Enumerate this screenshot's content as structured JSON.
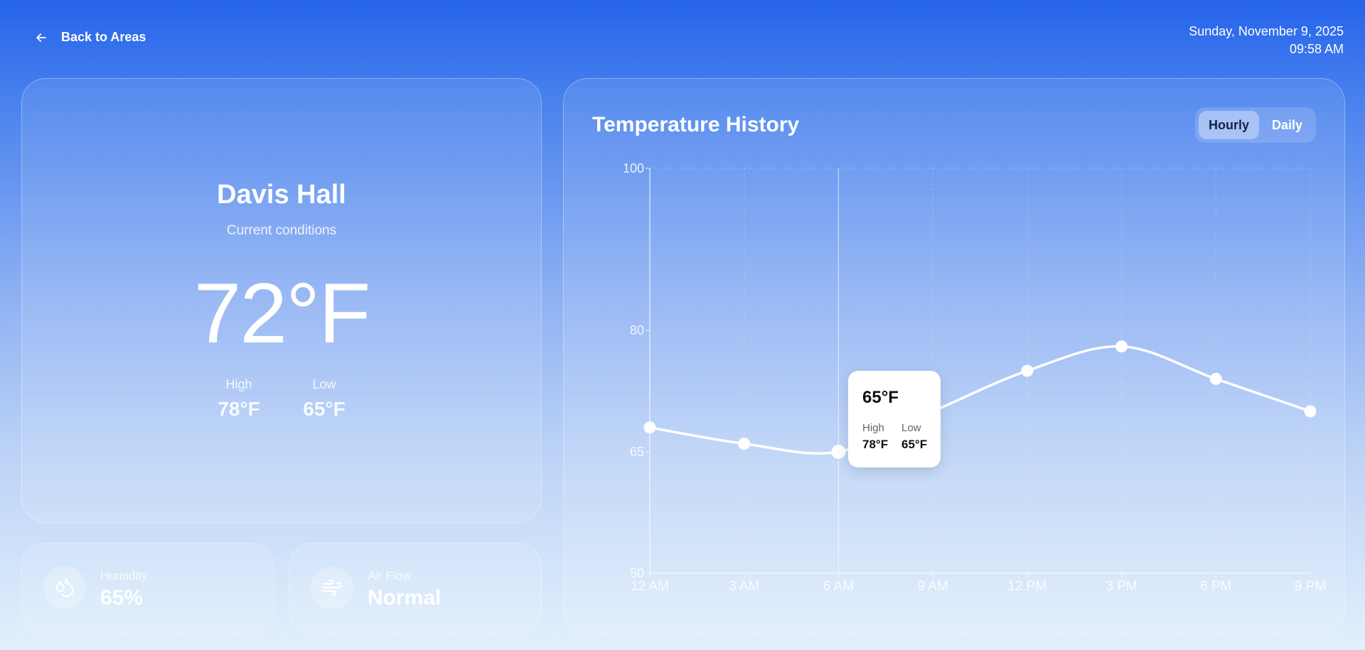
{
  "nav": {
    "back_label": "Back to Areas"
  },
  "header": {
    "date": "Sunday, November 9, 2025",
    "time": "09:58 AM"
  },
  "area": {
    "name": "Davis Hall",
    "subtitle": "Current conditions",
    "current_temp": "72°F",
    "high_label": "High",
    "high_value": "78°F",
    "low_label": "Low",
    "low_value": "65°F"
  },
  "stats": {
    "humidity": {
      "label": "Humidity",
      "value": "65%",
      "icon": "droplets-icon"
    },
    "airflow": {
      "label": "Air Flow",
      "value": "Normal",
      "icon": "wind-icon"
    }
  },
  "chart_panel": {
    "title": "Temperature History",
    "tabs": [
      {
        "label": "Hourly",
        "active": true
      },
      {
        "label": "Daily",
        "active": false
      }
    ]
  },
  "tooltip": {
    "value": "65°F",
    "high_label": "High",
    "high_value": "78°F",
    "low_label": "Low",
    "low_value": "65°F"
  },
  "chart_data": {
    "type": "line",
    "title": "Temperature History",
    "categories": [
      "12 AM",
      "3 AM",
      "6 AM",
      "9 AM",
      "12 PM",
      "3 PM",
      "6 PM",
      "9 PM"
    ],
    "series": [
      {
        "values": [
          68,
          66,
          65,
          70,
          75,
          78,
          74,
          70
        ]
      }
    ],
    "y_ticks": [
      50,
      65,
      80,
      100
    ],
    "ylim": [
      50,
      100
    ],
    "grid": true,
    "highlighted_category": "6 AM",
    "line_color": "#ffffff"
  }
}
